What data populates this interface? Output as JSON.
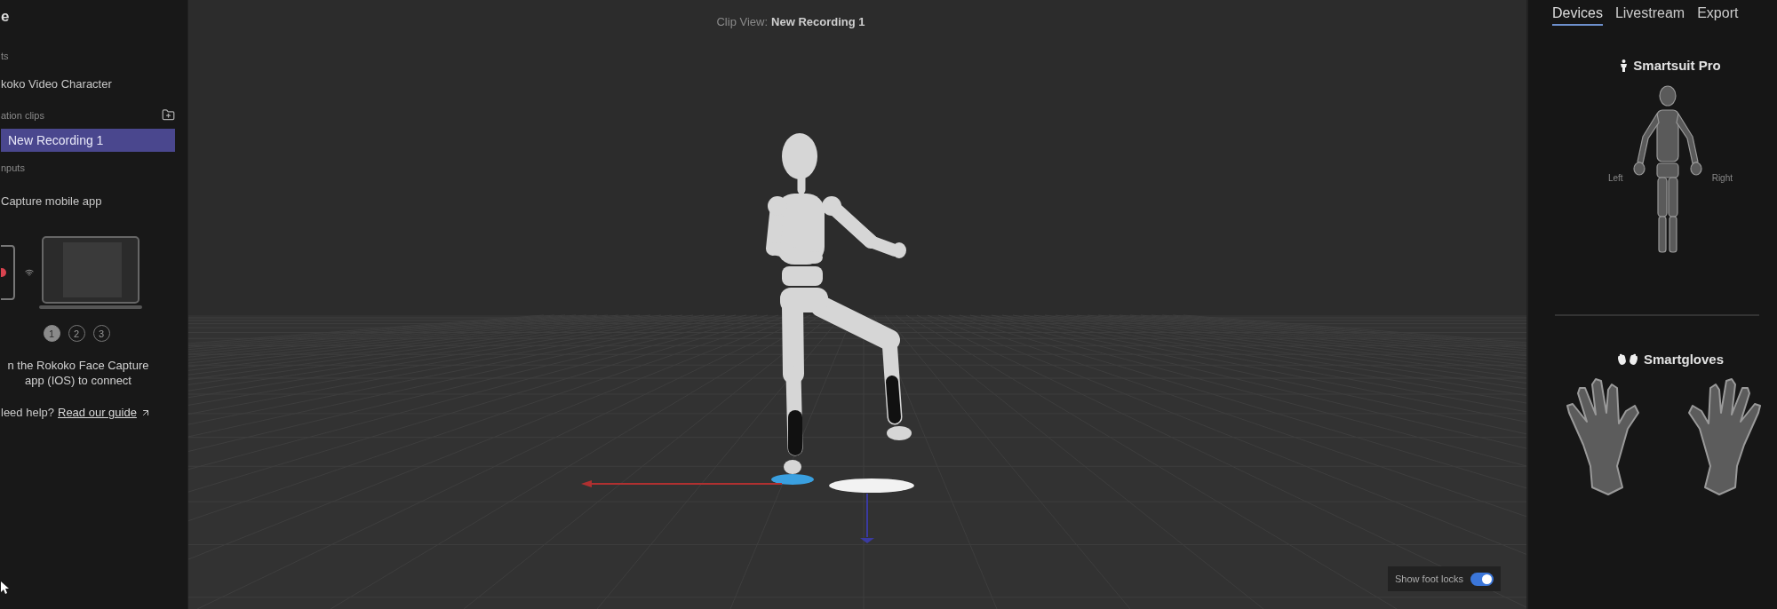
{
  "left_panel": {
    "title": "e",
    "section_label": "ts",
    "character": "koko Video Character",
    "clips_header": "ation clips",
    "clips": [
      {
        "label": "New Recording 1",
        "selected": true
      }
    ],
    "inputs_header": "nputs",
    "input_name": "Capture mobile app",
    "steps": [
      {
        "label": "1",
        "selected": true
      },
      {
        "label": "2",
        "selected": false
      },
      {
        "label": "3",
        "selected": false
      }
    ],
    "instruction": "n the Rokoko Face Capture\napp (IOS) to connect",
    "help_text": "leed help?",
    "help_link": "Read our guide"
  },
  "viewport": {
    "title_label": "Clip View:",
    "title_value": "New Recording 1",
    "foot_locks": {
      "label": "Show foot locks",
      "on": true
    }
  },
  "right_panel": {
    "tabs": [
      {
        "label": "Devices",
        "selected": true
      },
      {
        "label": "Livestream",
        "selected": false
      },
      {
        "label": "Export",
        "selected": false
      }
    ],
    "suit": {
      "title": "Smartsuit Pro",
      "left_label": "Left",
      "right_label": "Right"
    },
    "gloves": {
      "title": "Smartgloves"
    }
  }
}
